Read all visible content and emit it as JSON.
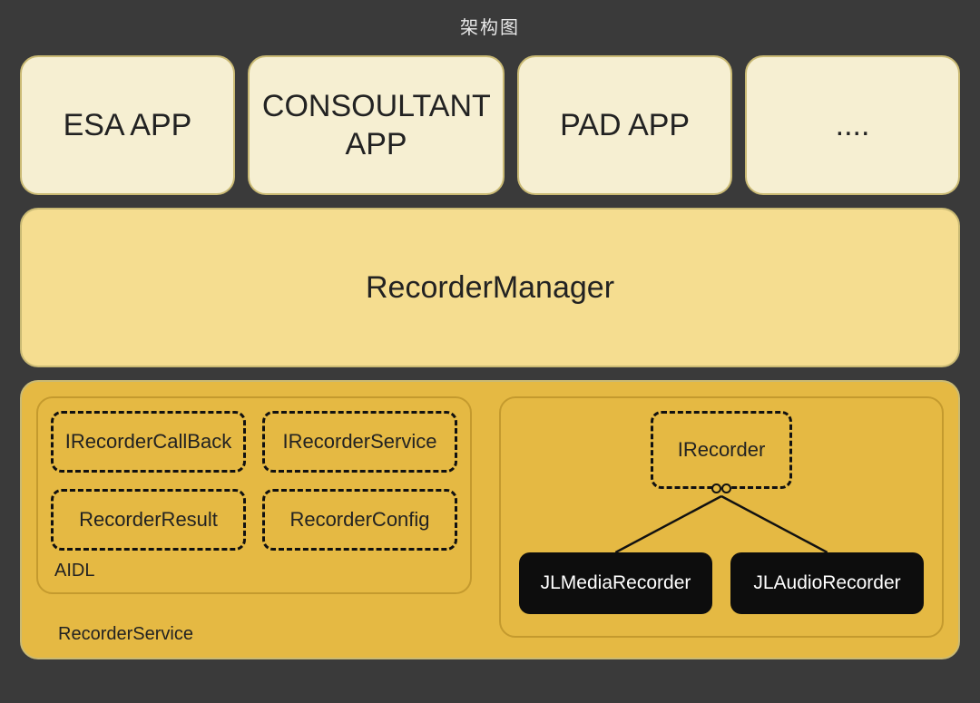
{
  "title": "架构图",
  "apps": {
    "esa": "ESA APP",
    "consultant": "CONSOULTANT APP",
    "pad": "PAD APP",
    "more": "...."
  },
  "manager": {
    "label": "RecorderManager"
  },
  "service": {
    "label": "RecorderService",
    "aidl": {
      "label": "AIDL",
      "items": {
        "callback": "IRecorderCallBack",
        "iservice": "IRecorderService",
        "result": "RecorderResult",
        "config": "RecorderConfig"
      }
    },
    "recorder_group": {
      "interface": "IRecorder",
      "impls": {
        "media": "JLMediaRecorder",
        "audio": "JLAudioRecorder"
      }
    }
  }
}
